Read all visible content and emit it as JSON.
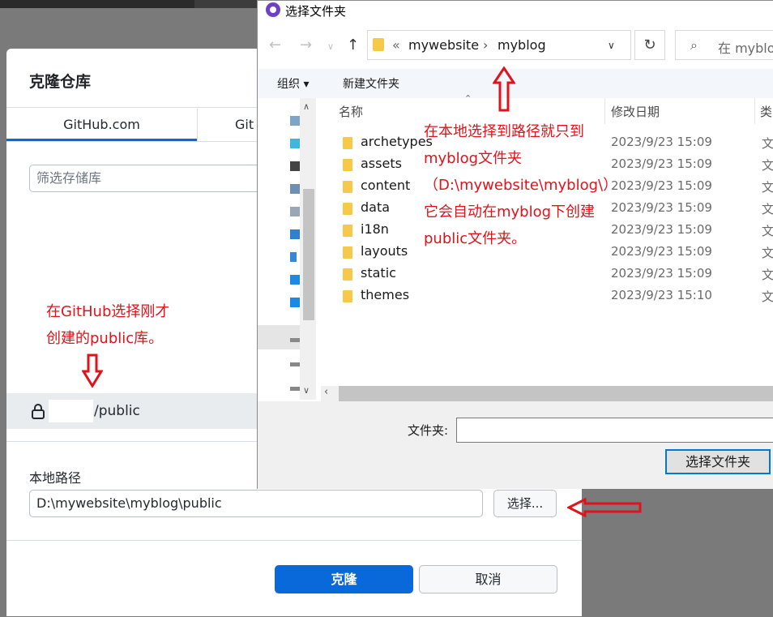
{
  "clone_dialog": {
    "title": "克隆仓库",
    "tabs": [
      "GitHub.com",
      "GitH"
    ],
    "filter_placeholder": "筛选存储库",
    "selected_repo": "/public",
    "local_path_label": "本地路径",
    "local_path_value": "D:\\mywebsite\\myblog\\public",
    "choose_button": "选择...",
    "clone_button": "克隆",
    "cancel_button": "取消"
  },
  "file_dialog": {
    "title": "选择文件夹",
    "address": {
      "overflow": "«",
      "segments": [
        "mywebsite",
        "myblog"
      ],
      "separator": "›"
    },
    "search_placeholder": "在 myblog",
    "toolbar": {
      "organize": "组织 ▾",
      "new_folder": "新建文件夹"
    },
    "columns": {
      "name": "名称",
      "modified": "修改日期",
      "type": "类"
    },
    "files": [
      {
        "name": "archetypes",
        "date": "2023/9/23 15:09",
        "type": "文"
      },
      {
        "name": "assets",
        "date": "2023/9/23 15:09",
        "type": "文"
      },
      {
        "name": "content",
        "date": "2023/9/23 15:09",
        "type": "文"
      },
      {
        "name": "data",
        "date": "2023/9/23 15:09",
        "type": "文"
      },
      {
        "name": "i18n",
        "date": "2023/9/23 15:09",
        "type": "文"
      },
      {
        "name": "layouts",
        "date": "2023/9/23 15:09",
        "type": "文"
      },
      {
        "name": "static",
        "date": "2023/9/23 15:09",
        "type": "文"
      },
      {
        "name": "themes",
        "date": "2023/9/23 15:10",
        "type": "文"
      }
    ],
    "folder_label": "文件夹:",
    "folder_value": "",
    "select_button": "选择文件夹"
  },
  "annotations": {
    "left_note": [
      "在GitHub选择刚才",
      "创建的public库。"
    ],
    "right_note": [
      "在本地选择到路径就只到",
      "myblog文件夹",
      "（D:\\mywebsite\\myblog\\）",
      "它会自动在myblog下创建",
      "public文件夹。"
    ],
    "color": "#e0131a"
  }
}
